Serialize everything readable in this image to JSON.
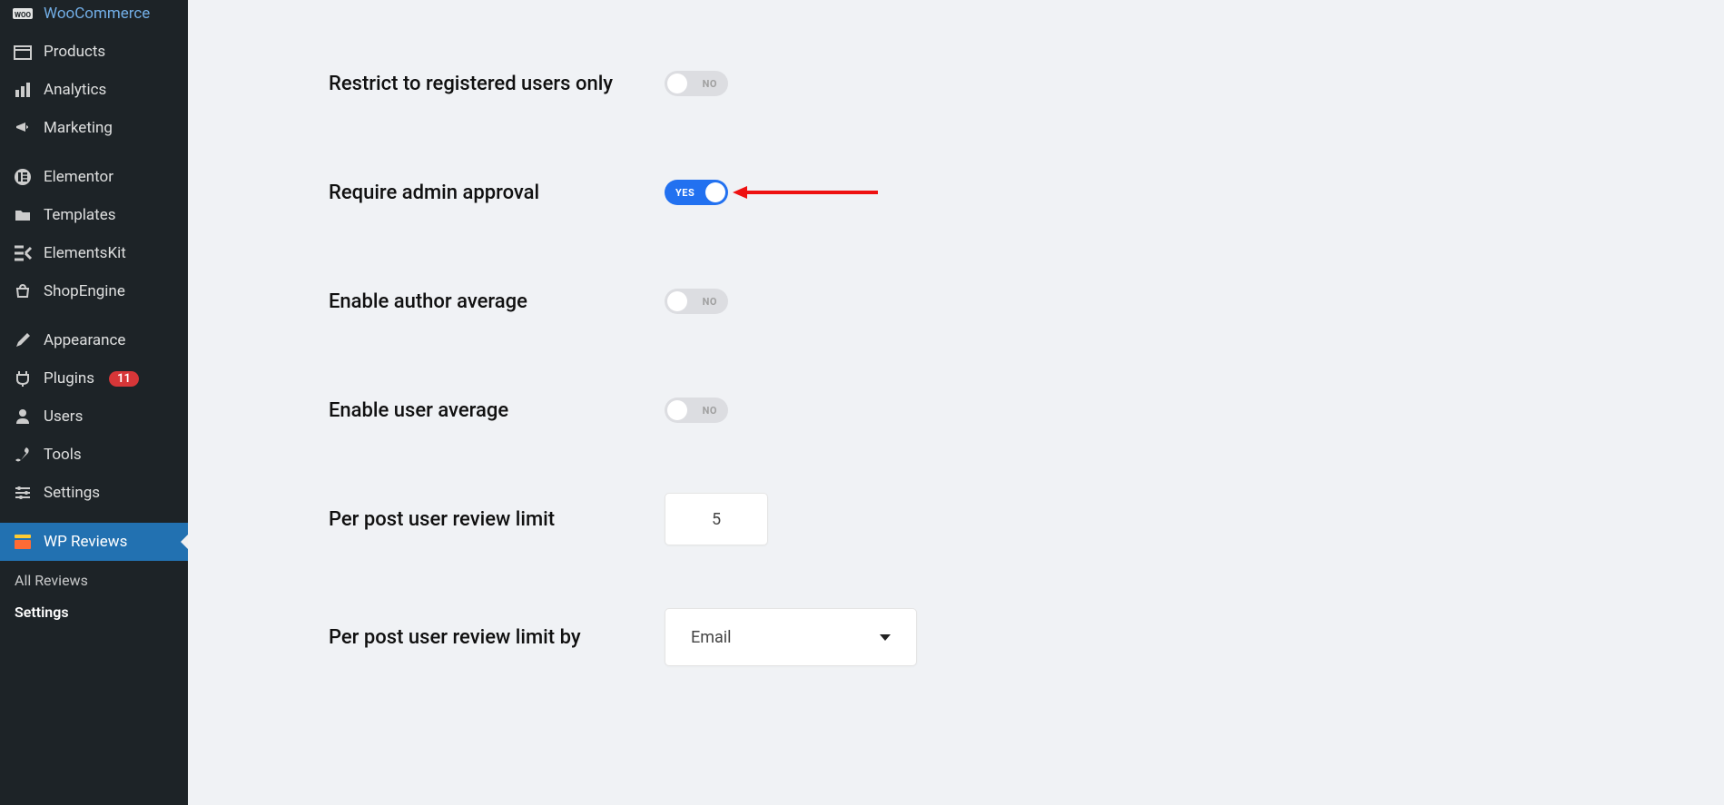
{
  "sidebar": {
    "items": [
      {
        "label": "WooCommerce"
      },
      {
        "label": "Products"
      },
      {
        "label": "Analytics"
      },
      {
        "label": "Marketing"
      },
      {
        "label": "Elementor"
      },
      {
        "label": "Templates"
      },
      {
        "label": "ElementsKit"
      },
      {
        "label": "ShopEngine"
      },
      {
        "label": "Appearance"
      },
      {
        "label": "Plugins",
        "badge": "11"
      },
      {
        "label": "Users"
      },
      {
        "label": "Tools"
      },
      {
        "label": "Settings"
      },
      {
        "label": "WP Reviews"
      }
    ],
    "submenu": [
      {
        "label": "All Reviews"
      },
      {
        "label": "Settings"
      }
    ]
  },
  "settings": {
    "restrict_label": "Restrict to registered users only",
    "approval_label": "Require admin approval",
    "author_avg_label": "Enable author average",
    "user_avg_label": "Enable user average",
    "limit_label": "Per post user review limit",
    "limit_value": "5",
    "limit_by_label": "Per post user review limit by",
    "limit_by_value": "Email",
    "toggle_yes": "YES",
    "toggle_no": "NO"
  }
}
